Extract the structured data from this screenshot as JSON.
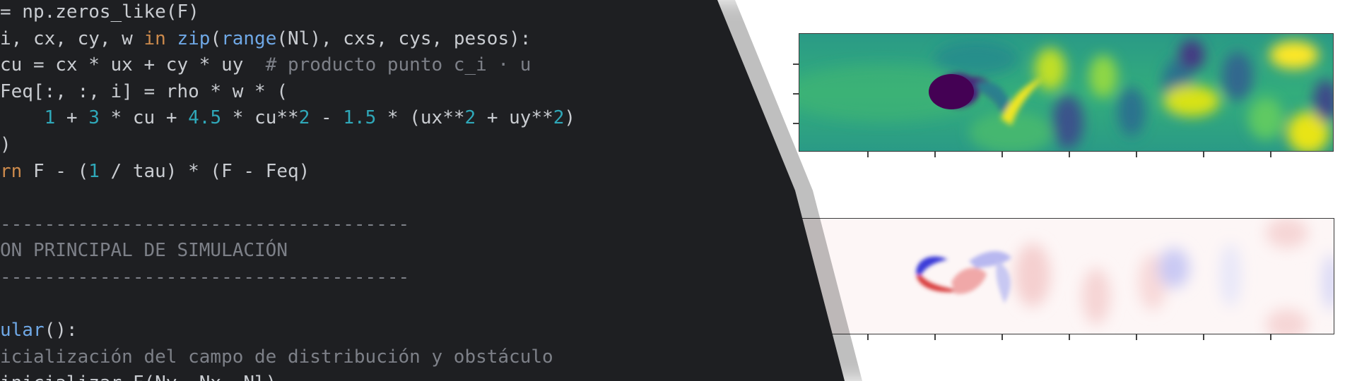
{
  "editor": {
    "lines": [
      [
        {
          "t": "= np.zeros_like(F)",
          "c": "tx"
        }
      ],
      [
        {
          "t": "i, cx, cy, w ",
          "c": "tx"
        },
        {
          "t": "in",
          "c": "kw"
        },
        {
          "t": " ",
          "c": "tx"
        },
        {
          "t": "zip",
          "c": "fn"
        },
        {
          "t": "(",
          "c": "tx"
        },
        {
          "t": "range",
          "c": "fn"
        },
        {
          "t": "(Nl), cxs, cys, pesos):",
          "c": "tx"
        }
      ],
      [
        {
          "t": "cu = cx * ux + cy * uy  ",
          "c": "tx"
        },
        {
          "t": "# producto punto c_i · u",
          "c": "cm"
        }
      ],
      [
        {
          "t": "Feq[:, :, i] = rho * w * (",
          "c": "tx"
        }
      ],
      [
        {
          "t": "    ",
          "c": "tx"
        },
        {
          "t": "1",
          "c": "num"
        },
        {
          "t": " + ",
          "c": "tx"
        },
        {
          "t": "3",
          "c": "num"
        },
        {
          "t": " * cu + ",
          "c": "tx"
        },
        {
          "t": "4.5",
          "c": "num"
        },
        {
          "t": " * cu**",
          "c": "tx"
        },
        {
          "t": "2",
          "c": "num"
        },
        {
          "t": " - ",
          "c": "tx"
        },
        {
          "t": "1.5",
          "c": "num"
        },
        {
          "t": " * (ux**",
          "c": "tx"
        },
        {
          "t": "2",
          "c": "num"
        },
        {
          "t": " + uy**",
          "c": "tx"
        },
        {
          "t": "2",
          "c": "num"
        },
        {
          "t": ")",
          "c": "tx"
        }
      ],
      [
        {
          "t": ")",
          "c": "tx"
        }
      ],
      [
        {
          "t": "rn",
          "c": "kw"
        },
        {
          "t": " F - (",
          "c": "tx"
        },
        {
          "t": "1",
          "c": "num"
        },
        {
          "t": " / tau) * (F - Feq)",
          "c": "tx"
        }
      ],
      [
        {
          "t": "",
          "c": "tx"
        }
      ],
      [
        {
          "t": "-------------------------------------",
          "c": "cm"
        }
      ],
      [
        {
          "t": "ON PRINCIPAL DE SIMULACIÓN",
          "c": "cm"
        }
      ],
      [
        {
          "t": "-------------------------------------",
          "c": "cm"
        }
      ],
      [
        {
          "t": "",
          "c": "tx"
        }
      ],
      [
        {
          "t": "ular",
          "c": "fn"
        },
        {
          "t": "():",
          "c": "tx"
        }
      ],
      [
        {
          "t": "icialización del campo de distribución y obstáculo",
          "c": "cm"
        }
      ],
      [
        {
          "t": "inicializar_F(Ny, Nx, Nl)",
          "c": "tx"
        }
      ]
    ]
  },
  "plots": {
    "top": {
      "colormap": "viridis"
    },
    "bottom": {
      "colormap": "bwr"
    }
  },
  "colors": {
    "editor_bg": "#1e1f22",
    "text": "#c9ccd1",
    "keyword": "#cc8a4c",
    "function": "#6fa8e6",
    "number": "#2fa8b9",
    "comment": "#7d8088"
  }
}
